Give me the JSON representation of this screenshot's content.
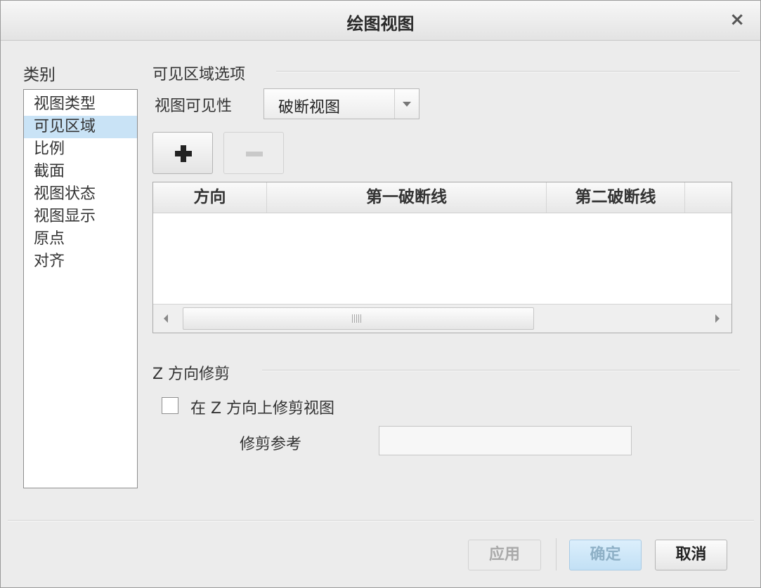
{
  "window": {
    "title": "绘图视图",
    "close_icon": "×"
  },
  "category": {
    "label": "类别",
    "items": [
      "视图类型",
      "可见区域",
      "比例",
      "截面",
      "视图状态",
      "视图显示",
      "原点",
      "对齐"
    ],
    "selected_index": 1
  },
  "visible_area": {
    "section_title": "可见区域选项",
    "visibility_label": "视图可见性",
    "visibility_value": "破断视图",
    "add_icon": "plus-icon",
    "remove_icon": "minus-icon",
    "table": {
      "columns": [
        "方向",
        "第一破断线",
        "第二破断线"
      ],
      "rows": []
    }
  },
  "z_clip": {
    "section_title": "Z 方向修剪",
    "checkbox_label": "在 Z 方向上修剪视图",
    "checked": false,
    "ref_label": "修剪参考",
    "ref_value": ""
  },
  "footer": {
    "apply": "应用",
    "ok": "确定",
    "cancel": "取消"
  },
  "colors": {
    "selected_bg": "#c9e3f6",
    "ok_button_bg": "#c2e0f5"
  }
}
